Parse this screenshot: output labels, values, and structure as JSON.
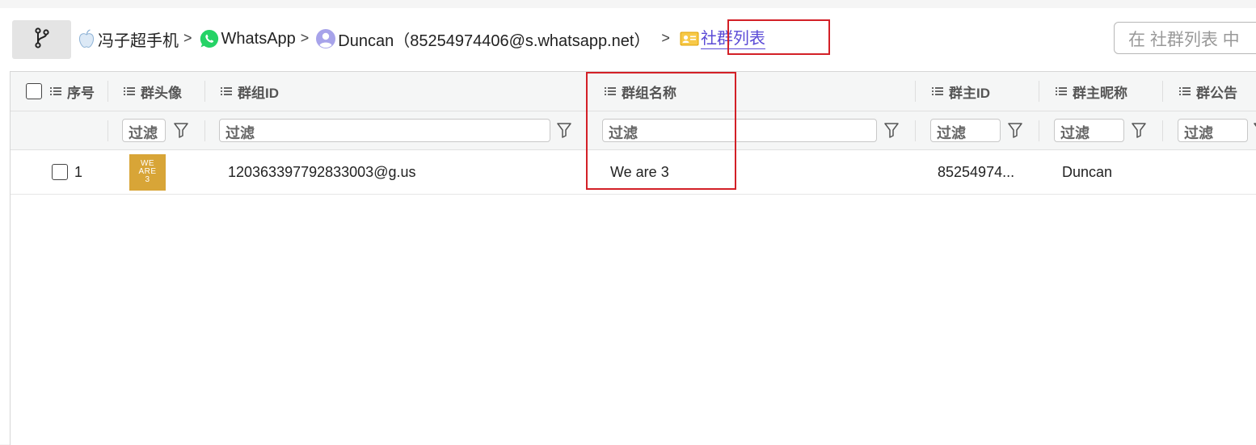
{
  "breadcrumb": {
    "items": [
      {
        "label": "冯子超手机",
        "icon": "apple-icon"
      },
      {
        "label": "WhatsApp",
        "icon": "whatsapp-icon"
      },
      {
        "label": "Duncan（85254974406@s.whatsapp.net）",
        "icon": "user-icon"
      },
      {
        "label": "社群列表",
        "icon": "contact-card-icon"
      }
    ],
    "separator": ">"
  },
  "search": {
    "placeholder": "在 社群列表 中"
  },
  "table": {
    "columns": [
      "序号",
      "群头像",
      "群组ID",
      "群组名称",
      "群主ID",
      "群主昵称",
      "群公告"
    ],
    "filter_placeholder": "过滤",
    "rows": [
      {
        "index": "1",
        "avatar_text": [
          "WE",
          "ARE",
          "3"
        ],
        "group_id": "120363397792833003@g.us",
        "group_name": "We are 3",
        "owner_id": "85254974...",
        "owner_nickname": "Duncan",
        "announcement": ""
      }
    ]
  },
  "colors": {
    "highlight_border": "#d32027",
    "link": "#5a4ad6",
    "whatsapp_green": "#25d366",
    "avatar_bg": "#d8a537"
  }
}
